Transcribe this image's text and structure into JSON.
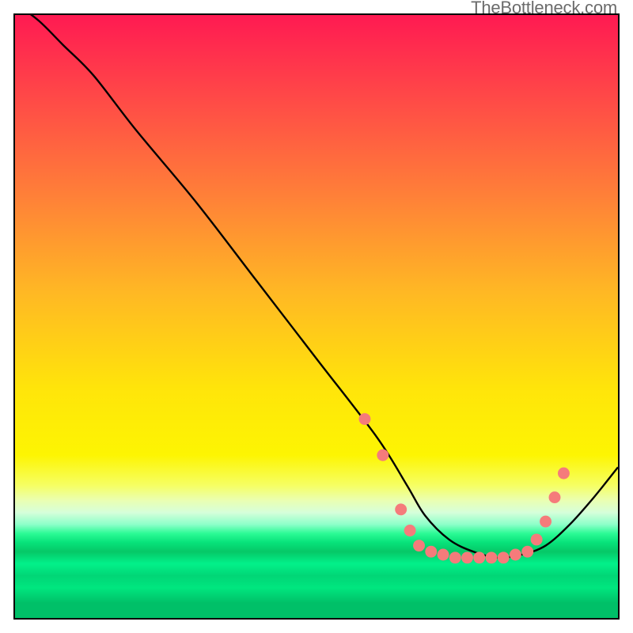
{
  "attribution": "TheBottleneck.com",
  "chart_data": {
    "type": "line",
    "title": "",
    "xlabel": "",
    "ylabel": "",
    "xlim": [
      0,
      100
    ],
    "ylim": [
      0,
      100
    ],
    "grid": false,
    "series": [
      {
        "name": "bottleneck-curve",
        "x": [
          0,
          4,
          8,
          13,
          20,
          30,
          40,
          50,
          60,
          65,
          68,
          72,
          76,
          80,
          84,
          88,
          92,
          96,
          100
        ],
        "y": [
          102,
          99,
          95,
          90,
          81,
          69,
          56,
          43,
          30,
          22,
          17,
          13,
          11,
          10,
          10.5,
          12,
          15.5,
          20,
          25
        ]
      }
    ],
    "markers": [
      {
        "x": 58,
        "y": 33
      },
      {
        "x": 61,
        "y": 27
      },
      {
        "x": 64,
        "y": 18
      },
      {
        "x": 65.5,
        "y": 14.5
      },
      {
        "x": 67,
        "y": 12
      },
      {
        "x": 69,
        "y": 11
      },
      {
        "x": 71,
        "y": 10.5
      },
      {
        "x": 73,
        "y": 10
      },
      {
        "x": 75,
        "y": 10
      },
      {
        "x": 77,
        "y": 10
      },
      {
        "x": 79,
        "y": 10
      },
      {
        "x": 81,
        "y": 10
      },
      {
        "x": 83,
        "y": 10.5
      },
      {
        "x": 85,
        "y": 11
      },
      {
        "x": 86.5,
        "y": 13
      },
      {
        "x": 88,
        "y": 16
      },
      {
        "x": 89.5,
        "y": 20
      },
      {
        "x": 91,
        "y": 24
      }
    ],
    "marker_color": "#f57b7b",
    "line_color": "#000000"
  }
}
